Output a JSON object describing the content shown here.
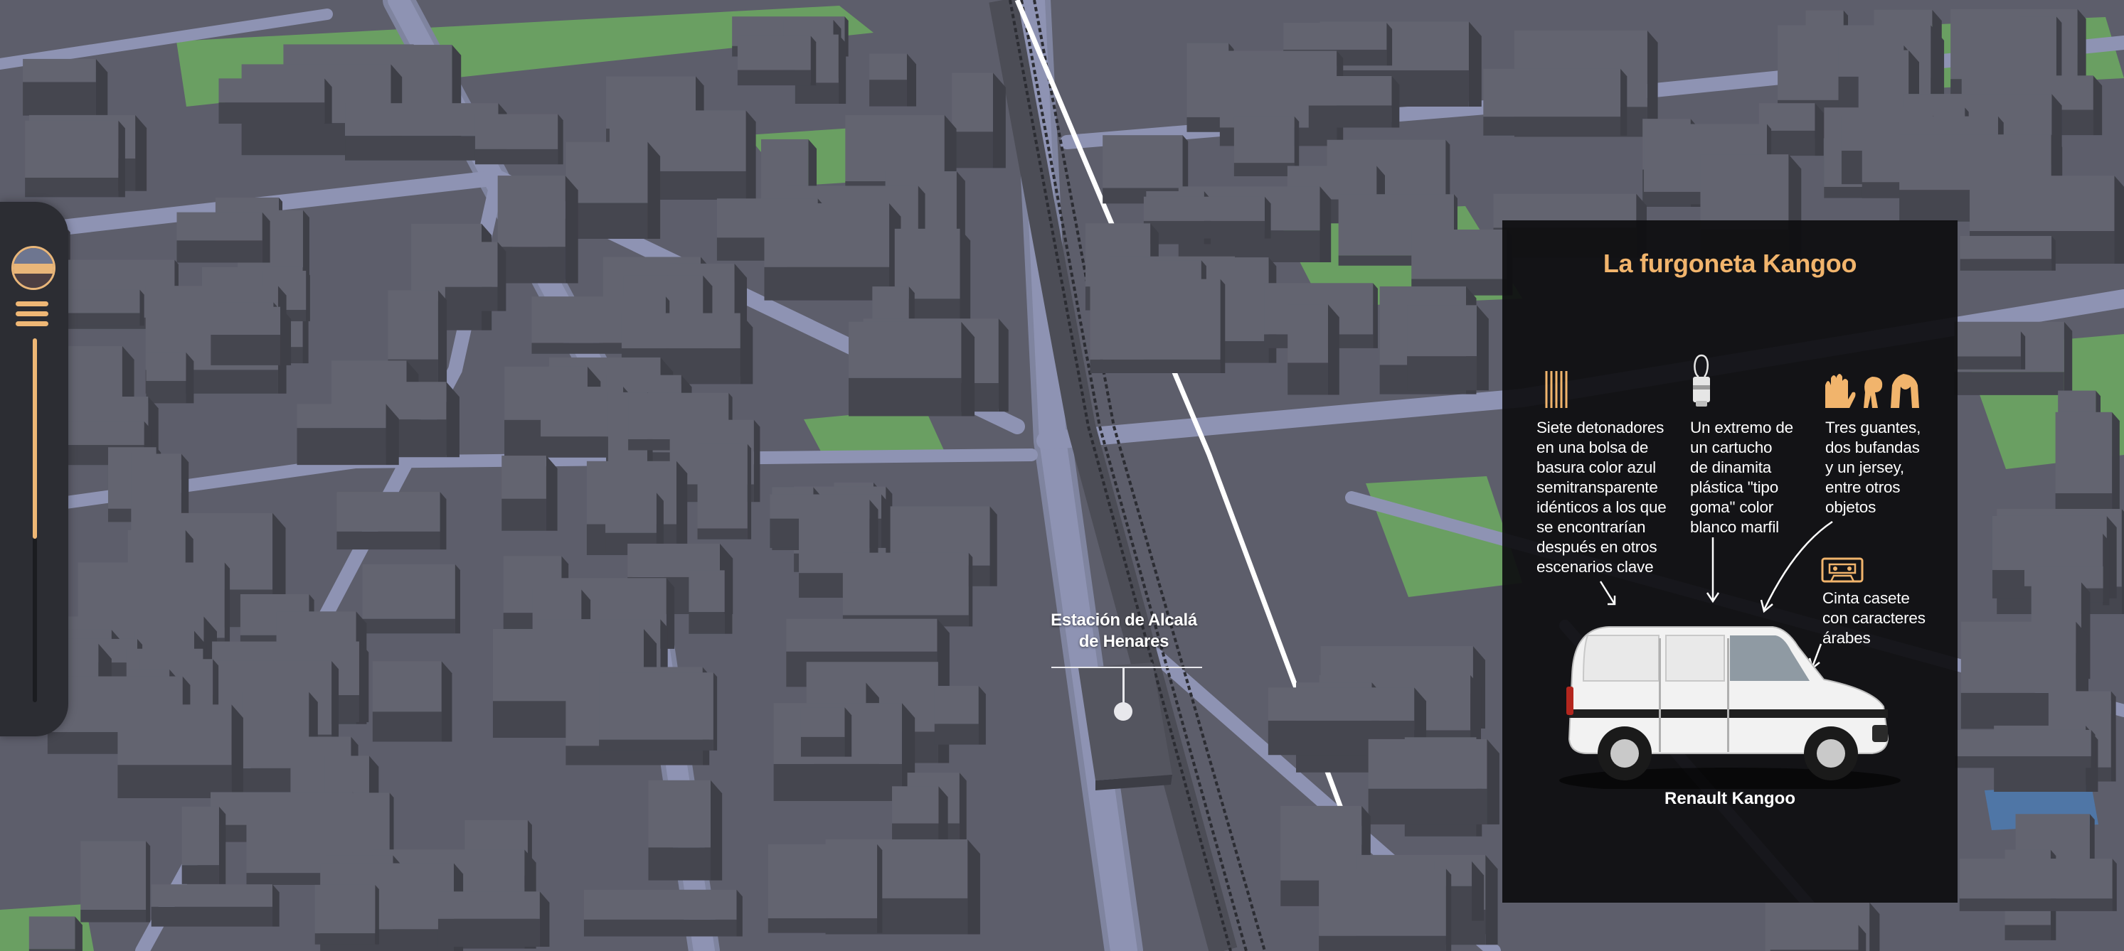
{
  "map": {
    "station_label_line1": "Estación de Alcalá",
    "station_label_line2": "de Henares",
    "colors": {
      "ground": "#5d5e6b",
      "building_top": "#636470",
      "building_side": "#45464f",
      "road": "#8e93b3",
      "park": "#6a9f62",
      "rail": "#ffffff"
    }
  },
  "nav": {
    "logo_icon": "globe-logo-icon",
    "menu_icon": "hamburger-menu-icon",
    "progress": 0.55,
    "accent": "#efb775"
  },
  "panel": {
    "title": "La furgoneta Kangoo",
    "items": [
      {
        "icon": "detonators-icon",
        "lines": [
          "Siete detonadores",
          "en una bolsa de",
          "basura color azul",
          "semitransparente",
          "idénticos a los que",
          "se encontrarían",
          "después en otros",
          "escenarios clave"
        ]
      },
      {
        "icon": "dynamite-cartridge-icon",
        "lines": [
          "Un extremo de",
          "un cartucho",
          "de dinamita",
          "plástica \"tipo",
          "goma\" color",
          "blanco marfil"
        ]
      },
      {
        "icon": "clothing-icon",
        "lines": [
          "Tres guantes,",
          "dos bufandas",
          "y un jersey,",
          "entre otros",
          "objetos"
        ]
      },
      {
        "icon": "cassette-icon",
        "lines": [
          "Cinta casete",
          "con caracteres",
          "árabes"
        ]
      }
    ],
    "van_caption": "Renault Kangoo",
    "accent": "#f1b46c"
  }
}
